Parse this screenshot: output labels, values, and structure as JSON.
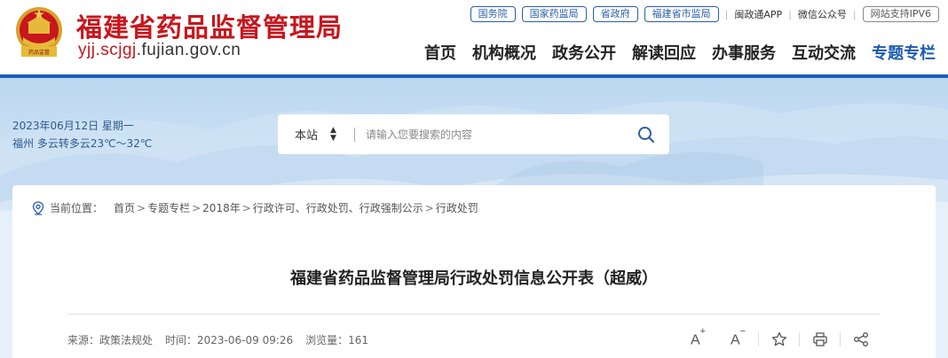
{
  "header": {
    "site_name": "福建省药品监督管理局",
    "domain_prefix": "yjj.scjgj",
    "domain_suffix": ".fujian.gov.cn",
    "emblem_text": "药品监管"
  },
  "top_links": {
    "state_council": "国务院",
    "nmpa": "国家药监局",
    "prov_gov": "省政府",
    "fj_samr": "福建省市监局",
    "app": "闽政通APP",
    "wechat": "微信公众号",
    "ipv6": "网站支持IPV6"
  },
  "nav": [
    "首页",
    "机构概况",
    "政务公开",
    "解读回应",
    "办事服务",
    "互动交流",
    "专题专栏"
  ],
  "banner": {
    "date": "2023年06月12日 星期一",
    "weather": "福州 多云转多云23℃～32℃"
  },
  "search": {
    "scope": "本站",
    "placeholder": "请输入您要搜索的内容"
  },
  "breadcrumb": {
    "label": "当前位置：",
    "items": [
      "首页",
      "专题专栏",
      "2018年",
      "行政许可、行政处罚、行政强制公示",
      "行政处罚"
    ]
  },
  "article": {
    "title": "福建省药品监督管理局行政处罚信息公开表（超威）",
    "source": "来源：政策法规处",
    "time": "时间：2023-06-09 09:26",
    "views": "浏览量：161"
  },
  "tools": {
    "font_up": "A",
    "font_up_sign": "+",
    "font_down": "A",
    "font_down_sign": "−"
  },
  "colors": {
    "brand_red": "#c8161d",
    "brand_blue": "#1b5db6",
    "active_nav": "#1d5cb0"
  }
}
